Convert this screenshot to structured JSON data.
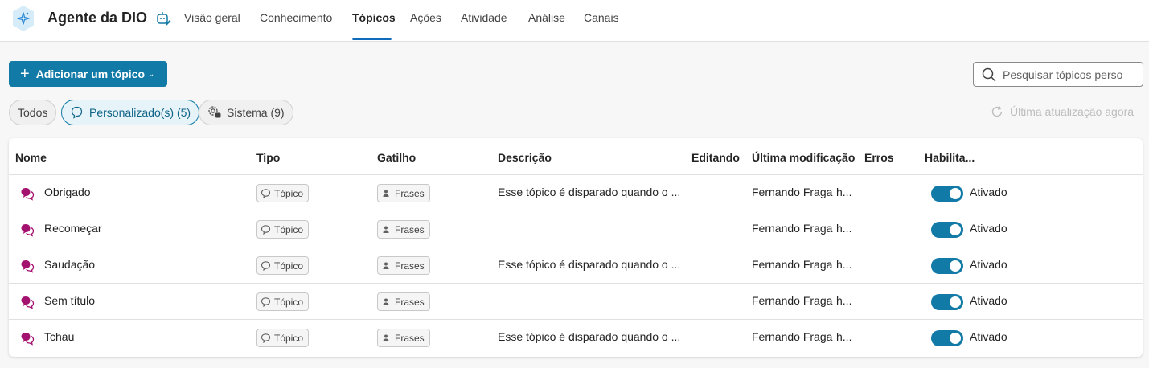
{
  "header": {
    "agent_name": "Agente da DIO",
    "tabs": [
      {
        "label": "Visão geral",
        "active": false
      },
      {
        "label": "Conhecimento",
        "active": false
      },
      {
        "label": "Tópicos",
        "active": true
      },
      {
        "label": "Ações",
        "active": false
      },
      {
        "label": "Atividade",
        "active": false
      },
      {
        "label": "Análise",
        "active": false
      },
      {
        "label": "Canais",
        "active": false
      }
    ]
  },
  "toolbar": {
    "add_topic_label": "Adicionar um tópico",
    "search_placeholder": "Pesquisar tópicos perso",
    "refresh_label": "Última atualização agora"
  },
  "filters": {
    "all": "Todos",
    "custom": "Personalizado(s) (5)",
    "system": "Sistema (9)"
  },
  "table": {
    "columns": [
      "Nome",
      "Tipo",
      "Gatilho",
      "Descrição",
      "Editando",
      "Última modificação",
      "Erros",
      "Habilita..."
    ],
    "rows": [
      {
        "name": "Obrigado",
        "type": "Tópico",
        "trigger": "Frases",
        "description": "Esse tópico é disparado quando o ...",
        "modified_by": "Fernando Fraga",
        "modified_time": "h...",
        "status": "Ativado",
        "enabled": true
      },
      {
        "name": "Recomeçar",
        "type": "Tópico",
        "trigger": "Frases",
        "description": "",
        "modified_by": "Fernando Fraga",
        "modified_time": "h...",
        "status": "Ativado",
        "enabled": true
      },
      {
        "name": "Saudação",
        "type": "Tópico",
        "trigger": "Frases",
        "description": "Esse tópico é disparado quando o ...",
        "modified_by": "Fernando Fraga",
        "modified_time": "h...",
        "status": "Ativado",
        "enabled": true
      },
      {
        "name": "Sem título",
        "type": "Tópico",
        "trigger": "Frases",
        "description": "",
        "modified_by": "Fernando Fraga",
        "modified_time": "h...",
        "status": "Ativado",
        "enabled": true
      },
      {
        "name": "Tchau",
        "type": "Tópico",
        "trigger": "Frases",
        "description": "Esse tópico é disparado quando o ...",
        "modified_by": "Fernando Fraga",
        "modified_time": "h...",
        "status": "Ativado",
        "enabled": true
      }
    ]
  },
  "colors": {
    "accent": "#117aa6",
    "topic_icon": "#a4126f",
    "tab_underline": "#0f6cbd"
  },
  "icons": {
    "logo": "copilot-agent-icon",
    "edit": "agent-settings-icon",
    "search": "search-icon",
    "custom_filter": "chat-bubbles-icon",
    "system_filter": "gear-chat-icon",
    "refresh": "refresh-icon",
    "row": "topic-chat-icon",
    "type_badge": "chat-bubble-icon",
    "trigger_badge": "people-icon"
  }
}
